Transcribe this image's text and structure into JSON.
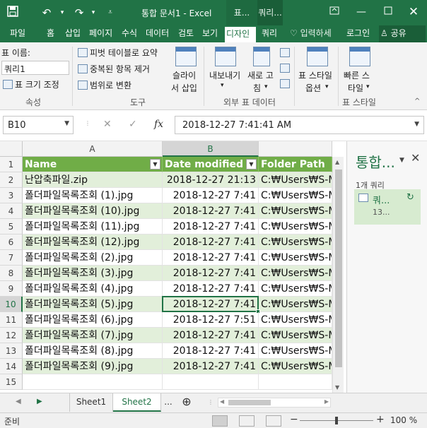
{
  "colors": {
    "brand": "#217346",
    "table_header": "#70ad47",
    "band": "#e2efda",
    "pane_item": "#d7ebd0"
  },
  "titlebar": {
    "save_icon": "save-icon",
    "undo_icon": "undo-icon",
    "redo_icon": "redo-icon",
    "customize_icon": "customize-qat-icon",
    "title": "통합 문서1 - Excel",
    "context_tab_1": "표...",
    "context_tab_2": "쿼리...",
    "ribbon_display_icon": "ribbon-display-icon"
  },
  "ribbon_tabs": [
    {
      "label": "파일"
    },
    {
      "label": "홈"
    },
    {
      "label": "삽입"
    },
    {
      "label": "페이지"
    },
    {
      "label": "수식"
    },
    {
      "label": "데이터"
    },
    {
      "label": "검토"
    },
    {
      "label": "보기"
    },
    {
      "label": "디자인"
    },
    {
      "label": "쿼리"
    }
  ],
  "tell_me": "입력하세",
  "login": "로그인",
  "share": "공유",
  "ribbon": {
    "properties": {
      "name_label": "표 이름:",
      "name_value": "쿼리1",
      "resize": "표 크기 조정",
      "group": "속성"
    },
    "tools": {
      "pivot": "피벗 테이블로 요약",
      "remove_dup": "중복된 항목 제거",
      "convert": "범위로 변환",
      "slicer_1": "슬라이",
      "slicer_2": "서 삽입",
      "group": "도구"
    },
    "external": {
      "export": "내보내기",
      "refresh_1": "새로 고",
      "refresh_2": "침",
      "group": "외부 표 데이터"
    },
    "style_options": {
      "label_1": "표 스타일",
      "label_2": "옵션",
      "group": ""
    },
    "styles": {
      "label_1": "빠른 스",
      "label_2": "타일",
      "group": "표 스타일"
    }
  },
  "formula_bar": {
    "name_box": "B10",
    "fx": "fx",
    "value": "2018-12-27  7:41:41 AM"
  },
  "grid": {
    "columns": [
      "A",
      "B"
    ],
    "selected_column": "B",
    "selected_row": "10",
    "headers": [
      "Name",
      "Date modified",
      "Folder Path"
    ],
    "rows": [
      {
        "num": "2",
        "name": "난압축파일.zip",
        "date": "2018-12-27 21:13",
        "path": "C:₩Users₩S-M"
      },
      {
        "num": "3",
        "name": "폴더파일목록조회 (1).jpg",
        "date": "2018-12-27 7:41",
        "path": "C:₩Users₩S-M"
      },
      {
        "num": "4",
        "name": "폴더파일목록조회 (10).jpg",
        "date": "2018-12-27 7:41",
        "path": "C:₩Users₩S-M"
      },
      {
        "num": "5",
        "name": "폴더파일목록조회 (11).jpg",
        "date": "2018-12-27 7:41",
        "path": "C:₩Users₩S-M"
      },
      {
        "num": "6",
        "name": "폴더파일목록조회 (12).jpg",
        "date": "2018-12-27 7:41",
        "path": "C:₩Users₩S-M"
      },
      {
        "num": "7",
        "name": "폴더파일목록조회 (2).jpg",
        "date": "2018-12-27 7:41",
        "path": "C:₩Users₩S-M"
      },
      {
        "num": "8",
        "name": "폴더파일목록조회 (3).jpg",
        "date": "2018-12-27 7:41",
        "path": "C:₩Users₩S-M"
      },
      {
        "num": "9",
        "name": "폴더파일목록조회 (4).jpg",
        "date": "2018-12-27 7:41",
        "path": "C:₩Users₩S-M"
      },
      {
        "num": "10",
        "name": "폴더파일목록조회 (5).jpg",
        "date": "2018-12-27 7:41",
        "path": "C:₩Users₩S-M"
      },
      {
        "num": "11",
        "name": "폴더파일목록조회 (6).jpg",
        "date": "2018-12-27 7:51",
        "path": "C:₩Users₩S-M"
      },
      {
        "num": "12",
        "name": "폴더파일목록조회 (7).jpg",
        "date": "2018-12-27 7:41",
        "path": "C:₩Users₩S-M"
      },
      {
        "num": "13",
        "name": "폴더파일목록조회 (8).jpg",
        "date": "2018-12-27 7:41",
        "path": "C:₩Users₩S-M"
      },
      {
        "num": "14",
        "name": "폴더파일목록조회 (9).jpg",
        "date": "2018-12-27 7:41",
        "path": "C:₩Users₩S-M"
      },
      {
        "num": "15",
        "name": "",
        "date": "",
        "path": ""
      }
    ]
  },
  "queries_pane": {
    "title": "통합...",
    "count": "1개 쿼리",
    "item_name": "쿼...",
    "item_rows": "13..."
  },
  "sheets": {
    "tabs": [
      "Sheet1",
      "Sheet2"
    ],
    "active": "Sheet2",
    "more": "...",
    "add": "⊕"
  },
  "status": {
    "ready": "준비",
    "zoom": "100 %"
  }
}
